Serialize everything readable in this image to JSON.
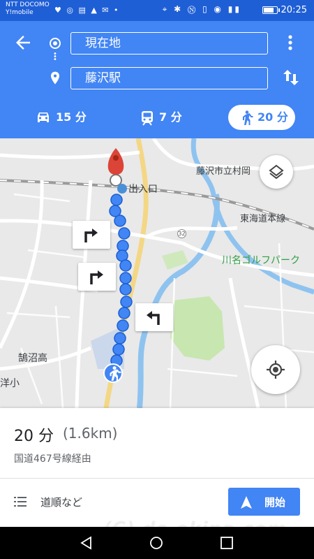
{
  "status_bar": {
    "carrier_line1": "NTT DOCOMO",
    "carrier_line2": "Y!mobile",
    "left_icons": "♥ ◎ ▤ ▲ ✉ •",
    "right_icons": "⌖ ✱ Ⓝ ▯ ◉ ▮▮",
    "battery_level": 0.8,
    "time": "20:25"
  },
  "header": {
    "origin": "現在地",
    "destination": "藤沢駅",
    "modes": [
      {
        "id": "car",
        "label": "15 分"
      },
      {
        "id": "train",
        "label": "7 分"
      },
      {
        "id": "walk",
        "label": "20 分",
        "selected": true
      }
    ]
  },
  "map": {
    "labels": {
      "library": "藤沢市立村岡",
      "entrance": "出入口",
      "railway": "東海道本線",
      "golf": "川名ゴルフパーク",
      "school": "鵠沼高",
      "school2": "洋小",
      "route_number": "32"
    },
    "colors": {
      "route": "#4285f4",
      "pin": "#db4437",
      "park": "#c8e6b0"
    }
  },
  "sheet": {
    "duration": "20 分",
    "distance": "(1.6km)",
    "via": "国道467号線経由",
    "steps_label": "道順など",
    "start_label": "開始"
  },
  "watermark": "(C) ds-okina.com"
}
